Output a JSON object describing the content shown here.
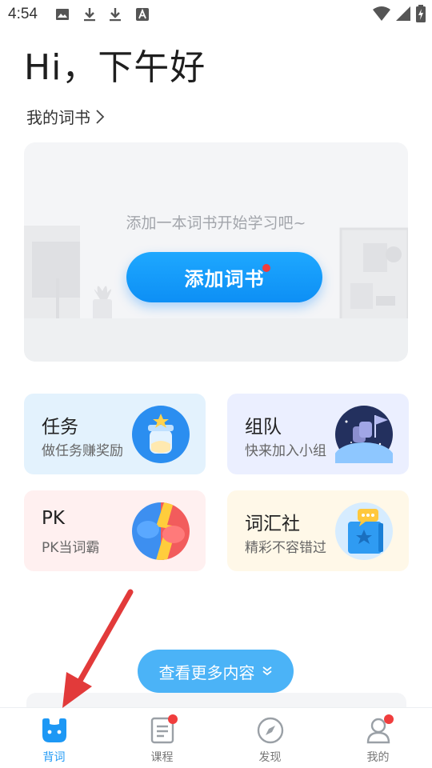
{
  "status_bar": {
    "time": "4:54"
  },
  "greeting": "Hi，下午好",
  "my_books": {
    "label": "我的词书"
  },
  "book_card": {
    "hint": "添加一本词书开始学习吧~",
    "button_label": "添加词书"
  },
  "tiles": [
    {
      "title": "任务",
      "subtitle": "做任务赚奖励",
      "icon": "task-jar-icon"
    },
    {
      "title": "组队",
      "subtitle": "快来加入小组",
      "icon": "team-planet-icon"
    },
    {
      "title": "PK",
      "subtitle": "PK当词霸",
      "icon": "pk-boxing-icon"
    },
    {
      "title": "词汇社",
      "subtitle": "精彩不容错过",
      "icon": "club-book-icon"
    }
  ],
  "more_button": {
    "label": "查看更多内容"
  },
  "bottom_nav": [
    {
      "label": "背词",
      "active": true
    },
    {
      "label": "课程"
    },
    {
      "label": "发现"
    },
    {
      "label": "我的"
    }
  ],
  "colors": {
    "accent": "#1d98f5",
    "badge": "#f03d3d",
    "annotation_arrow": "#e23a3a"
  }
}
